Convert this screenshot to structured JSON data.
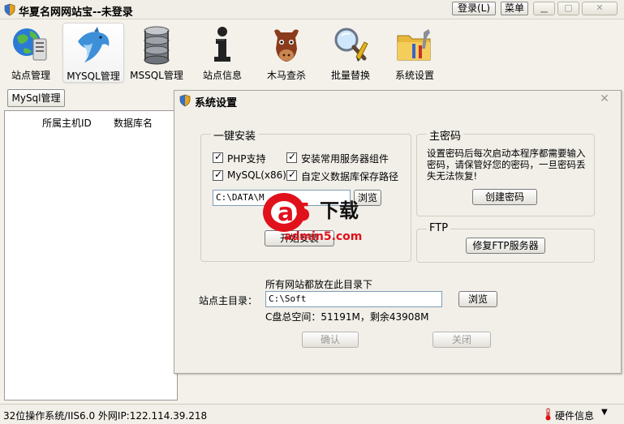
{
  "window": {
    "title": "华夏名网网站宝--未登录",
    "login_label": "登录(L)",
    "menu_label": "菜单",
    "min_glyph": "▁",
    "max_glyph": "▢",
    "close_glyph": "✕"
  },
  "toolbar": {
    "items": [
      {
        "label": "站点管理",
        "icon": "globe-server-icon"
      },
      {
        "label": "MYSQL管理",
        "icon": "dolphin-icon"
      },
      {
        "label": "MSSQL管理",
        "icon": "database-icon"
      },
      {
        "label": "站点信息",
        "icon": "info-icon"
      },
      {
        "label": "木马查杀",
        "icon": "horse-icon"
      },
      {
        "label": "批量替换",
        "icon": "magnifier-icon"
      },
      {
        "label": "系统设置",
        "icon": "folder-tools-icon"
      }
    ]
  },
  "left": {
    "tab_label": "MySql管理",
    "columns": [
      "所属主机ID",
      "数据库名"
    ]
  },
  "dialog": {
    "title": "系统设置",
    "close_glyph": "✕",
    "one_click": {
      "legend": "一键安装",
      "php": "PHP支持",
      "components": "安装常用服务器组件",
      "mysql": "MySQL(x86)",
      "custom_path": "自定义数据库保存路径",
      "path_value": "C:\\DATA\\M",
      "browse_label": "浏览",
      "install_label": "开始安装"
    },
    "master_password": {
      "legend": "主密码",
      "description": "设置密码后每次启动本程序都需要输入密码，请保管好您的密码，一旦密码丢失无法恢复!",
      "create_label": "创建密码"
    },
    "ftp": {
      "legend": "FTP",
      "repair_label": "修复FTP服务器"
    },
    "site_root": {
      "note": "所有网站都放在此目录下",
      "label": "站点主目录：",
      "value": "C:\\Soft",
      "browse_label": "浏览",
      "disk_info": "C盘总空间：51191M，剩余43908M"
    },
    "ok_label": "确认",
    "close_label": "关闭"
  },
  "status": {
    "text": "32位操作系统/IIS6.0 外网IP:122.114.39.218",
    "hw_label": "硬件信息",
    "arrow": "▼"
  },
  "watermark": {
    "brand": "a5",
    "sub": "下载",
    "url": "admin5.com"
  },
  "colors": {
    "accent": "#e0111b",
    "window_bg": "#f3f1ea"
  }
}
